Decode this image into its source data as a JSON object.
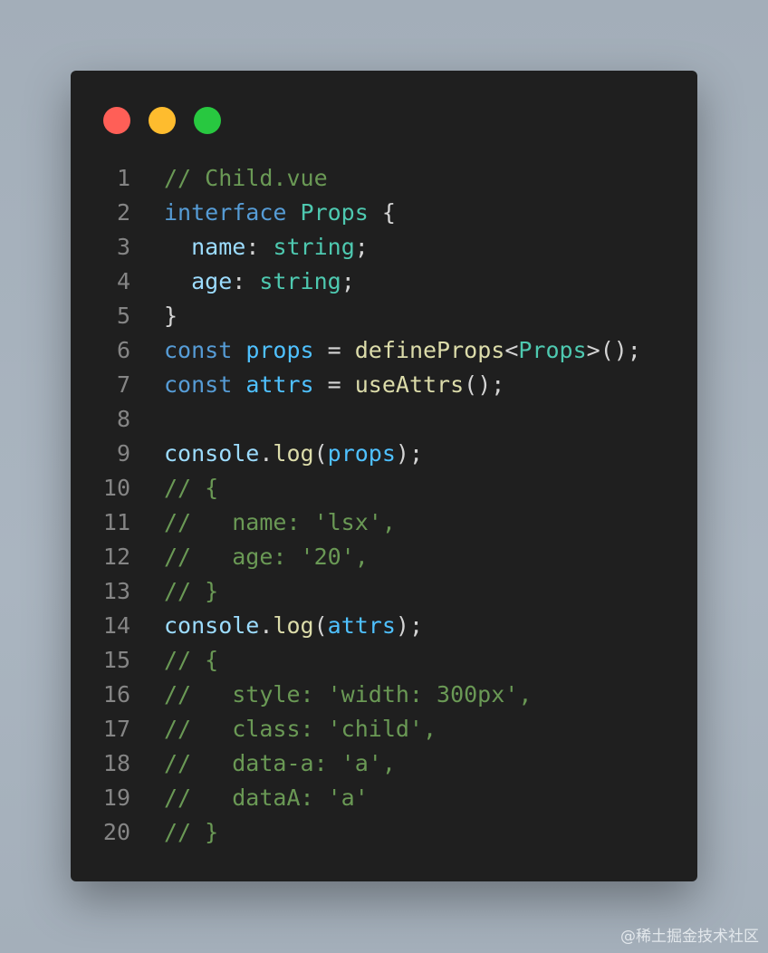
{
  "window": {
    "buttons": [
      {
        "name": "close",
        "color": "#ff5f57"
      },
      {
        "name": "minimize",
        "color": "#febc2e"
      },
      {
        "name": "maximize",
        "color": "#28c840"
      }
    ]
  },
  "code": {
    "lines": [
      {
        "num": "1",
        "tokens": [
          [
            "// Child.vue",
            "comment"
          ]
        ]
      },
      {
        "num": "2",
        "tokens": [
          [
            "interface ",
            "keyword"
          ],
          [
            "Props",
            "type"
          ],
          [
            " {",
            "plain"
          ]
        ]
      },
      {
        "num": "3",
        "tokens": [
          [
            "  ",
            "plain"
          ],
          [
            "name",
            "prop"
          ],
          [
            ": ",
            "plain"
          ],
          [
            "string",
            "type"
          ],
          [
            ";",
            "plain"
          ]
        ]
      },
      {
        "num": "4",
        "tokens": [
          [
            "  ",
            "plain"
          ],
          [
            "age",
            "prop"
          ],
          [
            ": ",
            "plain"
          ],
          [
            "string",
            "type"
          ],
          [
            ";",
            "plain"
          ]
        ]
      },
      {
        "num": "5",
        "tokens": [
          [
            "}",
            "plain"
          ]
        ]
      },
      {
        "num": "6",
        "tokens": [
          [
            "const ",
            "keyword"
          ],
          [
            "props",
            "var"
          ],
          [
            " = ",
            "plain"
          ],
          [
            "defineProps",
            "func"
          ],
          [
            "<",
            "plain"
          ],
          [
            "Props",
            "type"
          ],
          [
            ">();",
            "plain"
          ]
        ]
      },
      {
        "num": "7",
        "tokens": [
          [
            "const ",
            "keyword"
          ],
          [
            "attrs",
            "var"
          ],
          [
            " = ",
            "plain"
          ],
          [
            "useAttrs",
            "func"
          ],
          [
            "();",
            "plain"
          ]
        ]
      },
      {
        "num": "8",
        "tokens": []
      },
      {
        "num": "9",
        "tokens": [
          [
            "console",
            "prop"
          ],
          [
            ".",
            "plain"
          ],
          [
            "log",
            "func"
          ],
          [
            "(",
            "plain"
          ],
          [
            "props",
            "var"
          ],
          [
            ");",
            "plain"
          ]
        ]
      },
      {
        "num": "10",
        "tokens": [
          [
            "// {",
            "comment"
          ]
        ]
      },
      {
        "num": "11",
        "tokens": [
          [
            "//   name: 'lsx',",
            "comment"
          ]
        ]
      },
      {
        "num": "12",
        "tokens": [
          [
            "//   age: '20',",
            "comment"
          ]
        ]
      },
      {
        "num": "13",
        "tokens": [
          [
            "// }",
            "comment"
          ]
        ]
      },
      {
        "num": "14",
        "tokens": [
          [
            "console",
            "prop"
          ],
          [
            ".",
            "plain"
          ],
          [
            "log",
            "func"
          ],
          [
            "(",
            "plain"
          ],
          [
            "attrs",
            "var"
          ],
          [
            ");",
            "plain"
          ]
        ]
      },
      {
        "num": "15",
        "tokens": [
          [
            "// {",
            "comment"
          ]
        ]
      },
      {
        "num": "16",
        "tokens": [
          [
            "//   style: 'width: 300px',",
            "comment"
          ]
        ]
      },
      {
        "num": "17",
        "tokens": [
          [
            "//   class: 'child',",
            "comment"
          ]
        ]
      },
      {
        "num": "18",
        "tokens": [
          [
            "//   data-a: 'a',",
            "comment"
          ]
        ]
      },
      {
        "num": "19",
        "tokens": [
          [
            "//   dataA: 'a'",
            "comment"
          ]
        ]
      },
      {
        "num": "20",
        "tokens": [
          [
            "// }",
            "comment"
          ]
        ]
      }
    ]
  },
  "watermark": "@稀土掘金技术社区"
}
